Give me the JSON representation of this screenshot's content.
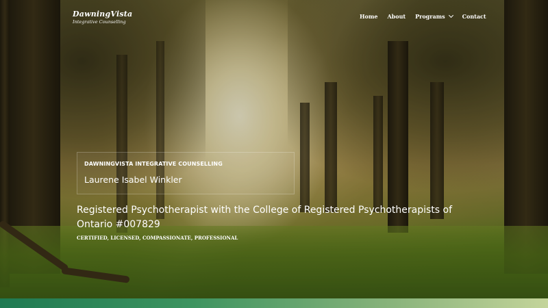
{
  "site": {
    "logo_name": "DawningVista",
    "logo_tagline": "Integrative Counselling"
  },
  "nav": {
    "items": [
      {
        "label": "Home"
      },
      {
        "label": "About"
      },
      {
        "label": "Programs",
        "dropdown": true
      },
      {
        "label": "Contact"
      }
    ]
  },
  "hero": {
    "org": "DAWNINGVISTA INTEGRATIVE COUNSELLING",
    "name": "Laurene Isabel Winkler",
    "headline": "Registered Psychotherapist with the College of Registered Psychotherapists of Ontario #007829",
    "tagline": "CERTIFIED, LICENSED, COMPASSIONATE, PROFESSIONAL"
  },
  "colors": {
    "footer_gradient_start": "#1f7a52",
    "footer_gradient_end": "#c4d49a",
    "text": "#ffffff"
  },
  "icons": {
    "dropdown": "chevron-down-icon"
  }
}
